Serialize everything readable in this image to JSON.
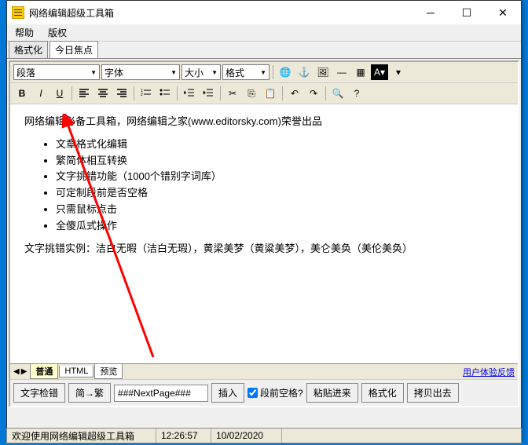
{
  "window": {
    "title": "网络编辑超级工具箱"
  },
  "menu": {
    "help": "帮助",
    "copyright": "版权"
  },
  "subtabs": {
    "format": "格式化",
    "today": "今日焦点"
  },
  "toolbar": {
    "paragraph": "段落",
    "font": "字体",
    "size": "大小",
    "style": "格式"
  },
  "content": {
    "intro": "网络编辑必备工具箱，网络编辑之家(www.editorsky.com)荣誉出品",
    "li1": "文章格式化编辑",
    "li2": "繁简体相互转换",
    "li3": "文字挑错功能（1000个错别字词库）",
    "li4": "可定制段前是否空格",
    "li5": "只需鼠标点击",
    "li6": "全傻瓜式操作",
    "example": "文字挑错实例：洁白无暇（洁白无瑕），黄梁美梦（黄粱美梦），美仑美奂（美伦美奂）"
  },
  "bottom_tabs": {
    "normal": "普通",
    "html": "HTML",
    "preview": "预览",
    "feedback": "用户体验反馈"
  },
  "actions": {
    "spellcheck": "文字检错",
    "simp2trad": "简→繁",
    "nextpage": "###NextPage###",
    "insert": "插入",
    "prespace": "段前空格?",
    "pastein": "粘贴进来",
    "format": "格式化",
    "copyout": "拷贝出去"
  },
  "status": {
    "welcome": "欢迎使用网络编辑超级工具箱",
    "time": "12:26:57",
    "date": "10/02/2020"
  }
}
